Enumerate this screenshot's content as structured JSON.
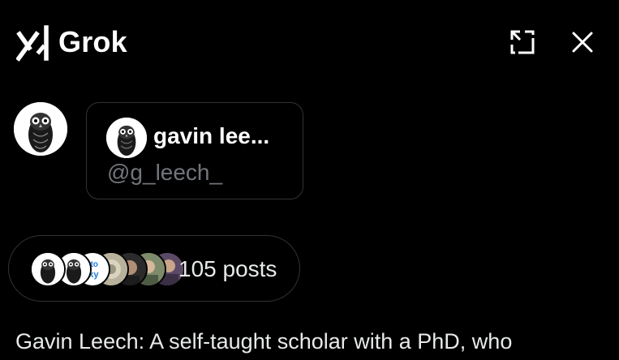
{
  "header": {
    "brand_name": "Grok",
    "icons": {
      "logo": "grok-logo-icon",
      "expand": "expand-icon",
      "close": "close-icon"
    }
  },
  "user": {
    "display_name": "gavin lee...",
    "handle": "@g_leech_",
    "avatar": "owl-avatar"
  },
  "posts": {
    "count_label": "105 posts",
    "stack_badge_text": "ed to\nesky"
  },
  "summary": {
    "text": "Gavin Leech: A self-taught scholar with a PhD, who"
  },
  "colors": {
    "background": "#000000",
    "text": "#e7e9ea",
    "muted": "#71767b",
    "border": "#2f3336"
  }
}
